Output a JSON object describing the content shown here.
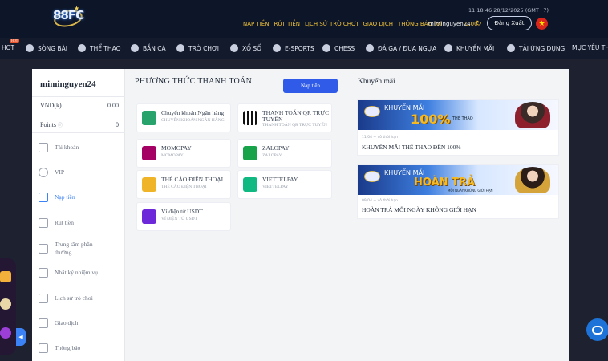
{
  "header": {
    "logo_text": "88FC",
    "datetime": "11:18:46 28/12/2025 (GMT+7)",
    "nav": [
      "NẠP TIỀN",
      "RÚT TIỀN",
      "LỊCH SỬ TRÒ CHƠI",
      "GIAO DỊCH",
      "THÔNG BÁO (0)"
    ],
    "username": "miminguyen24",
    "balance": "0.00",
    "logout_label": "Đăng Xuất"
  },
  "mainnav": {
    "hot_badge": "HOT",
    "items": [
      "HOT",
      "SÒNG BÀI",
      "THỂ THAO",
      "BẮN CÁ",
      "TRÒ CHƠI",
      "XỔ SỐ",
      "E-SPORTS",
      "CHESS",
      "ĐÁ GÀ / ĐUA NGỰA",
      "KHUYẾN MÃI",
      "TẢI ỨNG DỤNG",
      "MỤC YÊU TH"
    ]
  },
  "sidebar": {
    "name": "miminguyen24",
    "currency_label": "VND(k)",
    "currency_value": "0.00",
    "points_label": "Points",
    "points_value": "0",
    "items": [
      "Tài khoản",
      "VIP",
      "Nạp tiền",
      "Rút tiền",
      "Trung tâm phần thưởng",
      "Nhật ký nhiệm vụ",
      "Lịch sử trò chơi",
      "Giao dịch",
      "Thông báo"
    ]
  },
  "payment": {
    "title": "PHƯƠNG THỨC THANH TOÁN",
    "deposit_button": "Nạp tiền",
    "methods": [
      {
        "name": "Chuyển khoản Ngân hàng",
        "sub": "CHUYỂN KHOẢN NGÂN HÀNG",
        "icon": "bank-icon",
        "color": "#27a36b"
      },
      {
        "name": "THANH TOÁN QR TRỰC TUYẾN",
        "sub": "THANH TOÁN QR TRỰC TUYẾN",
        "icon": "qr-icon",
        "color": "#111827"
      },
      {
        "name": "MOMOPAY",
        "sub": "MOMOPAY",
        "icon": "momo-icon",
        "color": "#a50064"
      },
      {
        "name": "ZALOPAY",
        "sub": "ZALOPAY",
        "icon": "zalopay-icon",
        "color": "#16a34a"
      },
      {
        "name": "THẺ CÀO ĐIỆN THOẠI",
        "sub": "THẺ CÀO ĐIỆN THOẠI",
        "icon": "phone-card-icon",
        "color": "#f0b429"
      },
      {
        "name": "VIETTELPAY",
        "sub": "VIETTELPAY",
        "icon": "viettelpay-icon",
        "color": "#10b981"
      },
      {
        "name": "Ví điện tử USDT",
        "sub": "VÍ ĐIỆN TỬ USDT",
        "icon": "usdt-wallet-icon",
        "color": "#6d28d9"
      }
    ]
  },
  "promotions": {
    "title": "Khuyến mãi",
    "items": [
      {
        "banner_kind": "KHUYẾN MÃI",
        "banner_big": "100%",
        "banner_small": "THỂ THAO",
        "meta": "11/04 ~ vô thời hạn",
        "name": "KHUYẾN MÃI THỂ THAO ĐẾN 100%"
      },
      {
        "banner_kind": "KHUYẾN MÃI",
        "banner_big": "HOÀN TRẢ",
        "banner_small": "MỖI NGÀY KHÔNG GIỚI HẠN",
        "meta": "09/04 ~ vô thời hạn",
        "name": "HOÀN TRẢ MỖI NGÀY KHÔNG GIỚI HẠN"
      }
    ]
  }
}
